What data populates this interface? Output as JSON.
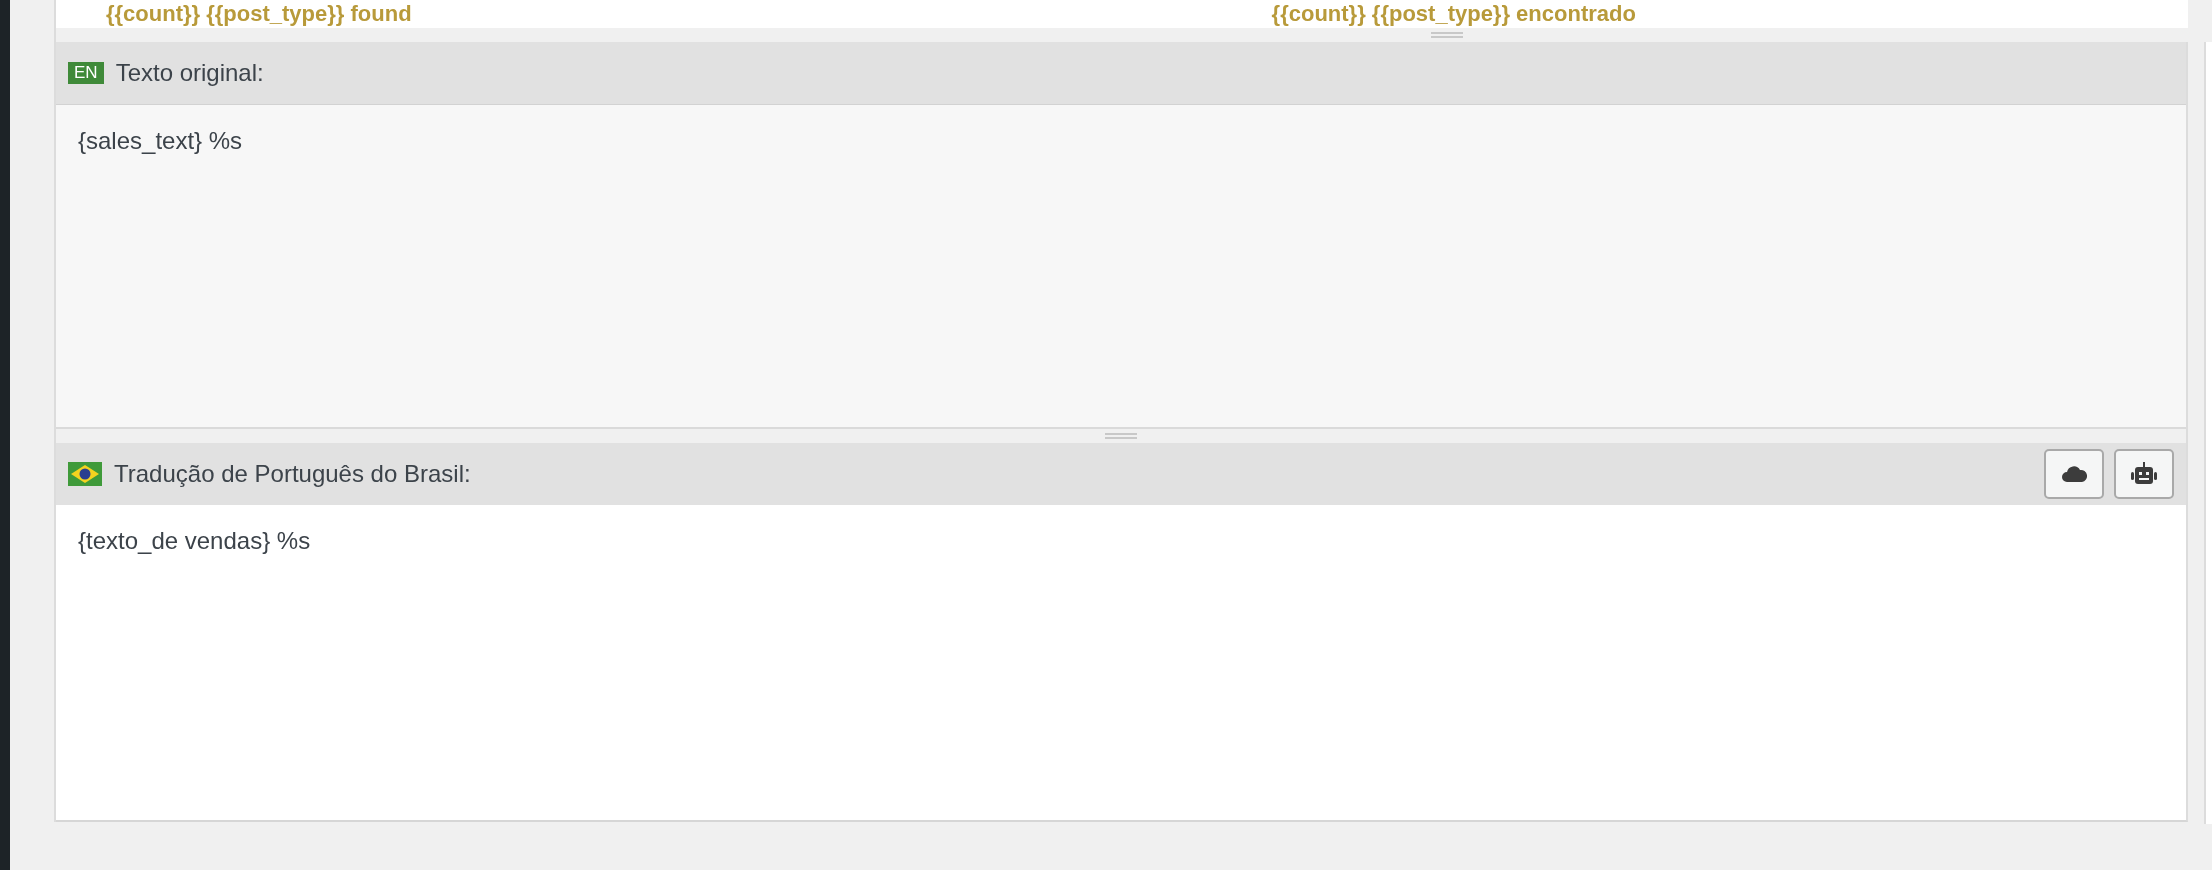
{
  "top_row": {
    "source_text": "{{count}} {{post_type}} found",
    "translation_text": "{{count}} {{post_type}} encontrado"
  },
  "original": {
    "language_badge": "EN",
    "label": "Texto original:",
    "text": "{sales_text} %s"
  },
  "translation": {
    "label": "Tradução de Português do Brasil:",
    "text": "{texto_de vendas} %s"
  }
}
